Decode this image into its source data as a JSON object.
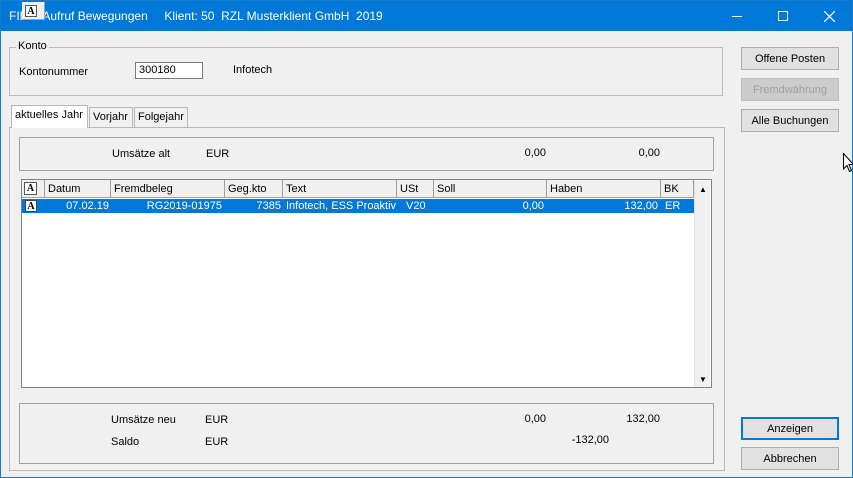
{
  "window": {
    "title": "FIBU: Aufruf Bewegungen     Klient: 50  RZL Musterklient GmbH  2019"
  },
  "konto": {
    "legend": "Konto",
    "kontonummer_label": "Kontonummer",
    "kontonummer_value": "300180",
    "name": "Infotech"
  },
  "buttons": {
    "offene_posten": "Offene Posten",
    "fremdwaehrung": "Fremdwährung",
    "alle_buchungen": "Alle Buchungen",
    "anzeigen": "Anzeigen",
    "abbrechen": "Abbrechen"
  },
  "tabs": [
    {
      "label": "aktuelles Jahr"
    },
    {
      "label": "Vorjahr"
    },
    {
      "label": "Folgejahr"
    }
  ],
  "top_summary": {
    "label": "Umsätze alt",
    "currency": "EUR",
    "soll": "0,00",
    "haben": "0,00"
  },
  "table": {
    "headers": [
      "Datum",
      "Fremdbeleg",
      "Geg.kto",
      "Text",
      "USt",
      "Soll",
      "Haben",
      "BK"
    ],
    "rows": [
      {
        "datum": "07.02.19",
        "fremdbeleg": "RG2019-01975",
        "gegkto": "7385",
        "text": "Infotech, ESS Proaktiv",
        "ust": "V20",
        "soll": "0,00",
        "haben": "132,00",
        "bk": "ER"
      }
    ]
  },
  "bottom_summary": {
    "umsaetze_neu_label": "Umsätze neu",
    "umsaetze_neu_currency": "EUR",
    "umsaetze_neu_soll": "0,00",
    "umsaetze_neu_haben": "132,00",
    "saldo_label": "Saldo",
    "saldo_currency": "EUR",
    "saldo_value": "-132,00"
  },
  "colors": {
    "titlebar": "#0078d7",
    "selection": "#0078d7"
  }
}
